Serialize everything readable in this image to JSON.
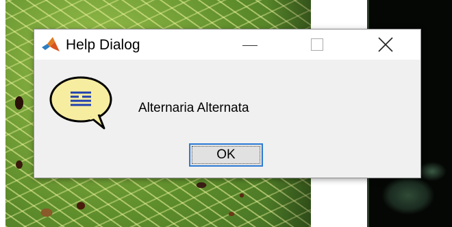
{
  "background": {
    "left_image": "leaf-image",
    "right_image": "dark-leaf-image"
  },
  "dialog": {
    "title": "Help Dialog",
    "message": "Alternaria Alternata",
    "ok_label": "OK",
    "app_icon": "matlab-icon",
    "help_icon": "help-speech-bubble-icon",
    "window_controls": {
      "minimize_icon": "minimize-icon",
      "maximize_icon": "maximize-icon",
      "close_icon": "close-icon"
    }
  },
  "colors": {
    "titlebar": "#ffffff",
    "dialog_body": "#f0f0f0",
    "focus_border": "#2d7bd6",
    "help_bubble": "#f7eda0",
    "help_lines": "#1f3fb0"
  }
}
